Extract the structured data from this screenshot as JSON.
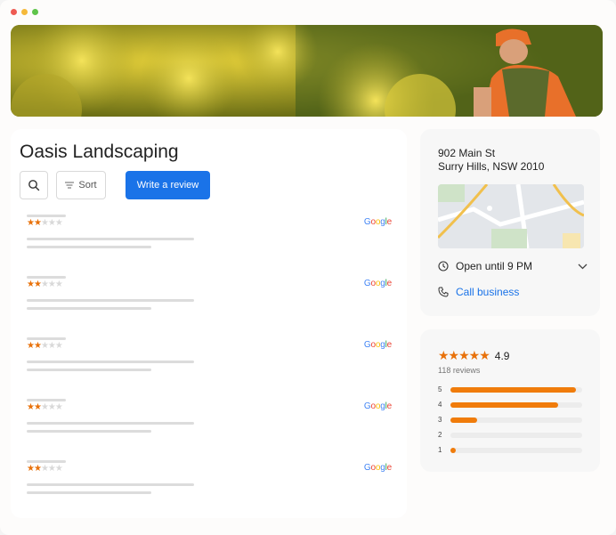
{
  "window": {
    "dots": [
      "#ee5a52",
      "#f5b93a",
      "#5fc44a"
    ]
  },
  "business": {
    "name": "Oasis Landscaping"
  },
  "toolbar": {
    "search_icon": "search-icon",
    "sort_label": "Sort",
    "sort_icon": "sort-lines-icon",
    "write_review_label": "Write a review"
  },
  "reviews": [
    {
      "stars": 2,
      "source": "Google"
    },
    {
      "stars": 2,
      "source": "Google"
    },
    {
      "stars": 2,
      "source": "Google"
    },
    {
      "stars": 2,
      "source": "Google"
    },
    {
      "stars": 2,
      "source": "Google"
    }
  ],
  "location": {
    "address_line1": "902 Main St",
    "address_line2": "Surry Hills, NSW 2010",
    "hours": "Open until 9 PM",
    "call_label": "Call business",
    "call_color": "#1a73e8"
  },
  "rating": {
    "value": "4.9",
    "count_label": "118 reviews",
    "stars": 5,
    "distribution": [
      {
        "label": "5",
        "fraction": 0.95
      },
      {
        "label": "4",
        "fraction": 0.82
      },
      {
        "label": "3",
        "fraction": 0.2
      },
      {
        "label": "2",
        "fraction": 0.0
      },
      {
        "label": "1",
        "fraction": 0.04
      }
    ]
  },
  "colors": {
    "accent": "#1a73e8",
    "star": "#e8710a",
    "bar": "#f07c0b"
  }
}
